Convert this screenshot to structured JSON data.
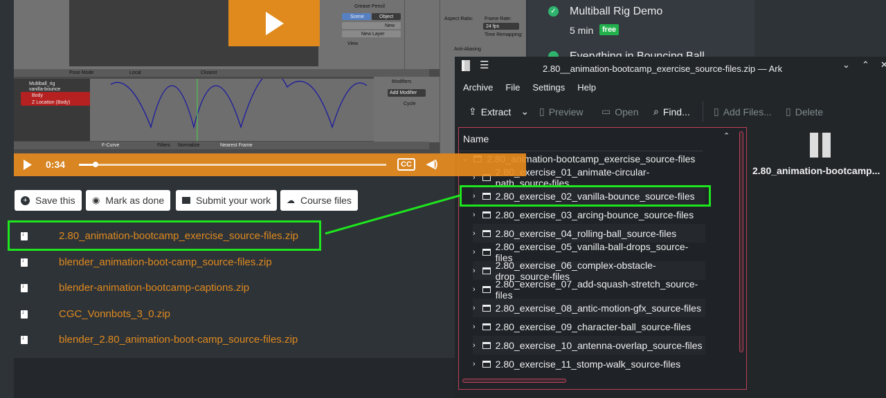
{
  "video": {
    "time": "0:34",
    "progress_percent": 5,
    "cc_label": "CC",
    "blender_labels": [
      "Multiball_rig",
      "vanilla-bounce",
      "Body",
      "Z Location (Body)",
      "Grease Pencil",
      "Scene",
      "Object",
      "New",
      "New Layer",
      "View",
      "Modifiers",
      "Add Modifier",
      "Cycle",
      "Filters",
      "Normalize",
      "Nearest Frame",
      "F-Curve",
      "Pose Mode",
      "Local",
      "Closest",
      "Aspect Ratio:",
      "Frame Rate:",
      "24 fps",
      "Time Remapping:",
      "Anti-Aliasing"
    ]
  },
  "actions": [
    {
      "label": "Save this",
      "icon": "plus-circle-icon"
    },
    {
      "label": "Mark as done",
      "icon": "eye-icon"
    },
    {
      "label": "Submit your work",
      "icon": "folder-upload-icon"
    },
    {
      "label": "Course files",
      "icon": "cloud-download-icon"
    }
  ],
  "files": [
    "2.80_animation-bootcamp_exercise_source-files.zip",
    "blender_animation-boot-camp_source-files.zip",
    "blender-animation-bootcamp-captions.zip",
    "CGC_Vonnbots_3_0.zip",
    "blender_2.80_animation-boot-camp_source-files.zip"
  ],
  "sidebar": {
    "lessons": [
      {
        "title": "Multiball Rig Demo",
        "duration": "5 min",
        "badge": "free",
        "status": "completed"
      },
      {
        "title": "Everything in Bouncing Ball",
        "status": "completed"
      }
    ]
  },
  "ark": {
    "title": "2.80__animation-bootcamp_exercise_source-files.zip — Ark",
    "menu": [
      "Archive",
      "File",
      "Settings",
      "Help"
    ],
    "toolbar": {
      "extract": "Extract",
      "preview": "Preview",
      "open": "Open",
      "find": "Find...",
      "add_files": "Add Files...",
      "delete": "Delete"
    },
    "column_header": "Name",
    "root": "2.80_animation-bootcamp_exercise_source-files",
    "children": [
      "2.80_exercise_01_animate-circular-path_source-files",
      "2.80_exercise_02_vanilla-bounce_source-files",
      "2.80_exercise_03_arcing-bounce_source-files",
      "2.80_exercise_04_rolling-ball_source-files",
      "2.80_exercise_05_vanilla-ball-drops_source-files",
      "2.80_exercise_06_complex-obstacle-drop_source-files",
      "2.80_exercise_07_add-squash-stretch_source-files",
      "2.80_exercise_08_antic-motion-gfx_source-files",
      "2.80_exercise_09_character-ball_source-files",
      "2.80_exercise_10_antenna-overlap_source-files",
      "2.80_exercise_11_stomp-walk_source-files"
    ],
    "preview_name": "2.80_animation-bootcamp..."
  },
  "colors": {
    "accent": "#e08a1e",
    "highlight": "#1ee61e",
    "free_badge": "#22b14c",
    "focus_border": "#c0405a"
  }
}
